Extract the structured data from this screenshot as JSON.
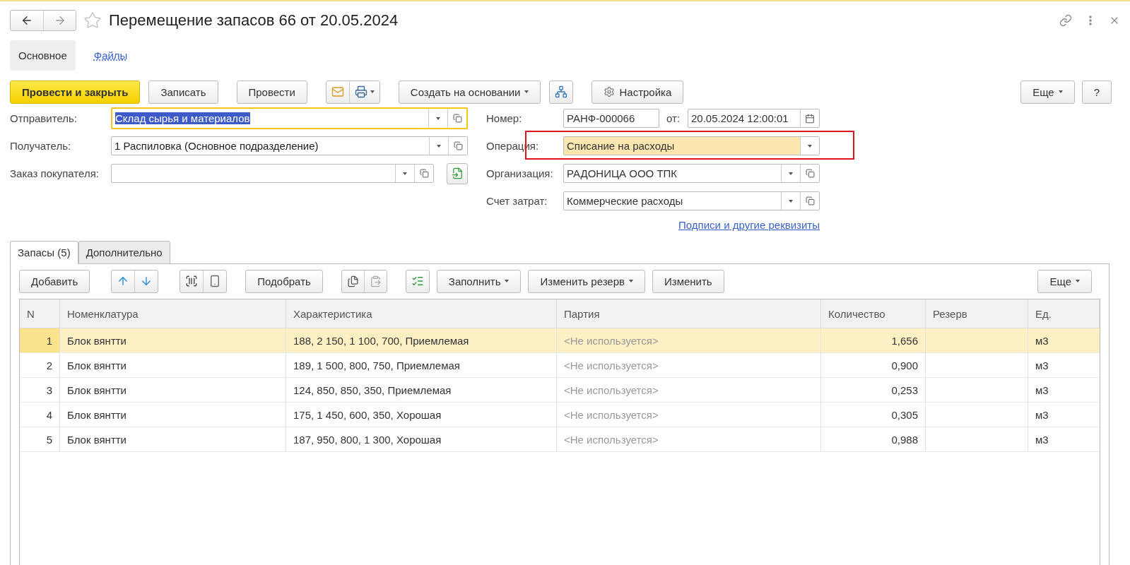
{
  "window": {
    "title": "Перемещение запасов 66 от 20.05.2024",
    "starred": false
  },
  "nav_tabs": [
    {
      "label": "Основное",
      "selected": true
    },
    {
      "label": "Файлы",
      "selected": false
    }
  ],
  "toolbar": {
    "post_close": "Провести и закрыть",
    "save": "Записать",
    "post": "Провести",
    "create_based": "Создать на основании",
    "settings": "Настройка",
    "more": "Еще",
    "help": "?"
  },
  "left_fields": [
    {
      "label": "Отправитель:",
      "value": "Склад сырья и материалов",
      "focused": true
    },
    {
      "label": "Получатель:",
      "value": "1 Распиловка (Основное подразделение)",
      "focused": false
    },
    {
      "label": "Заказ покупателя:",
      "focused": false
    }
  ],
  "number": {
    "label": "Номер:",
    "value": "РАНФ-000066"
  },
  "date": {
    "label": "от:",
    "value": "20.05.2024 12:00:01"
  },
  "right_fields": [
    {
      "label": "Операция:",
      "value": "Списание на расходы",
      "highlighted": true,
      "open_button": false
    },
    {
      "label": "Организация:",
      "value": "РАДОНИЦА ООО ТПК",
      "highlighted": false,
      "open_button": true
    },
    {
      "label": "Счет затрат:",
      "value": "Коммерческие расходы",
      "highlighted": false,
      "open_button": true
    }
  ],
  "signatures_link": "Подписи и другие реквизиты",
  "tabs": [
    {
      "label": "Запасы (5)",
      "selected": true
    },
    {
      "label": "Дополнительно",
      "selected": false
    }
  ],
  "table_toolbar": {
    "add": "Добавить",
    "pick": "Подобрать",
    "fill": "Заполнить",
    "change_reserve": "Изменить резерв",
    "change": "Изменить",
    "more": "Еще"
  },
  "table": {
    "columns": [
      "N",
      "Номенклатура",
      "Характеристика",
      "Партия",
      "Количество",
      "Резерв",
      "Ед."
    ],
    "rows": [
      {
        "n": "1",
        "item": "Блок вянтти",
        "spec": "188, 2 150, 1 100, 700, Приемлемая",
        "batch": "<Не используется>",
        "qty": "1,656",
        "unit": "м3",
        "selected": true
      },
      {
        "n": "2",
        "item": "Блок вянтти",
        "spec": "189, 1 500, 800, 750, Приемлемая",
        "batch": "<Не используется>",
        "qty": "0,900",
        "unit": "м3",
        "selected": false
      },
      {
        "n": "3",
        "item": "Блок вянтти",
        "spec": "124, 850, 850, 350, Приемлемая",
        "batch": "<Не используется>",
        "qty": "0,253",
        "unit": "м3",
        "selected": false
      },
      {
        "n": "4",
        "item": "Блок вянтти",
        "spec": "175, 1 450, 600, 350, Хорошая",
        "batch": "<Не используется>",
        "qty": "0,305",
        "unit": "м3",
        "selected": false
      },
      {
        "n": "5",
        "item": "Блок вянтти",
        "spec": "187, 950, 800, 1 300, Хорошая",
        "batch": "<Не используется>",
        "qty": "0,988",
        "unit": "м3",
        "selected": false
      }
    ]
  }
}
